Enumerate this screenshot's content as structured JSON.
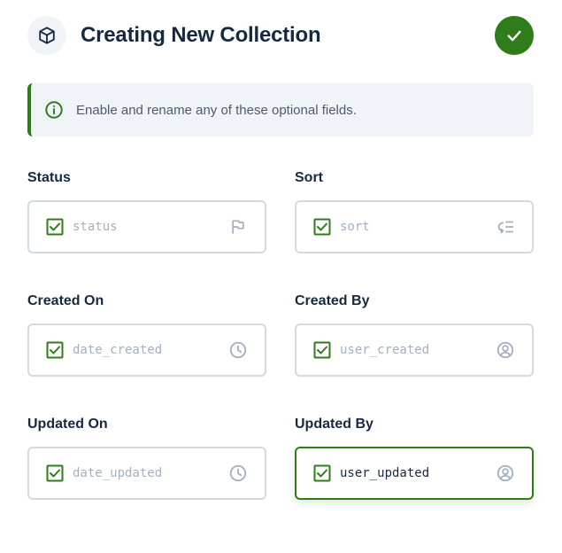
{
  "header": {
    "title": "Creating New Collection",
    "icon": "box-icon",
    "done_icon": "check-icon"
  },
  "notice": {
    "icon": "info-icon",
    "text": "Enable and rename any of these optional fields."
  },
  "fields": [
    {
      "label": "Status",
      "value": "status",
      "checked": true,
      "icon": "flag-icon"
    },
    {
      "label": "Sort",
      "value": "sort",
      "checked": true,
      "icon": "sort-icon"
    },
    {
      "label": "Created On",
      "value": "date_created",
      "checked": true,
      "icon": "clock-icon"
    },
    {
      "label": "Created By",
      "value": "user_created",
      "checked": true,
      "icon": "user-icon"
    },
    {
      "label": "Updated On",
      "value": "date_updated",
      "checked": true,
      "icon": "clock-icon"
    },
    {
      "label": "Updated By",
      "value": "user_updated",
      "checked": true,
      "icon": "user-icon",
      "focused": true
    }
  ],
  "colors": {
    "accent": "#2e7d1a",
    "title": "#172940",
    "placeholder": "#a2b0bf",
    "border": "#d3dae4",
    "notice_bg": "#f0f4f9"
  }
}
